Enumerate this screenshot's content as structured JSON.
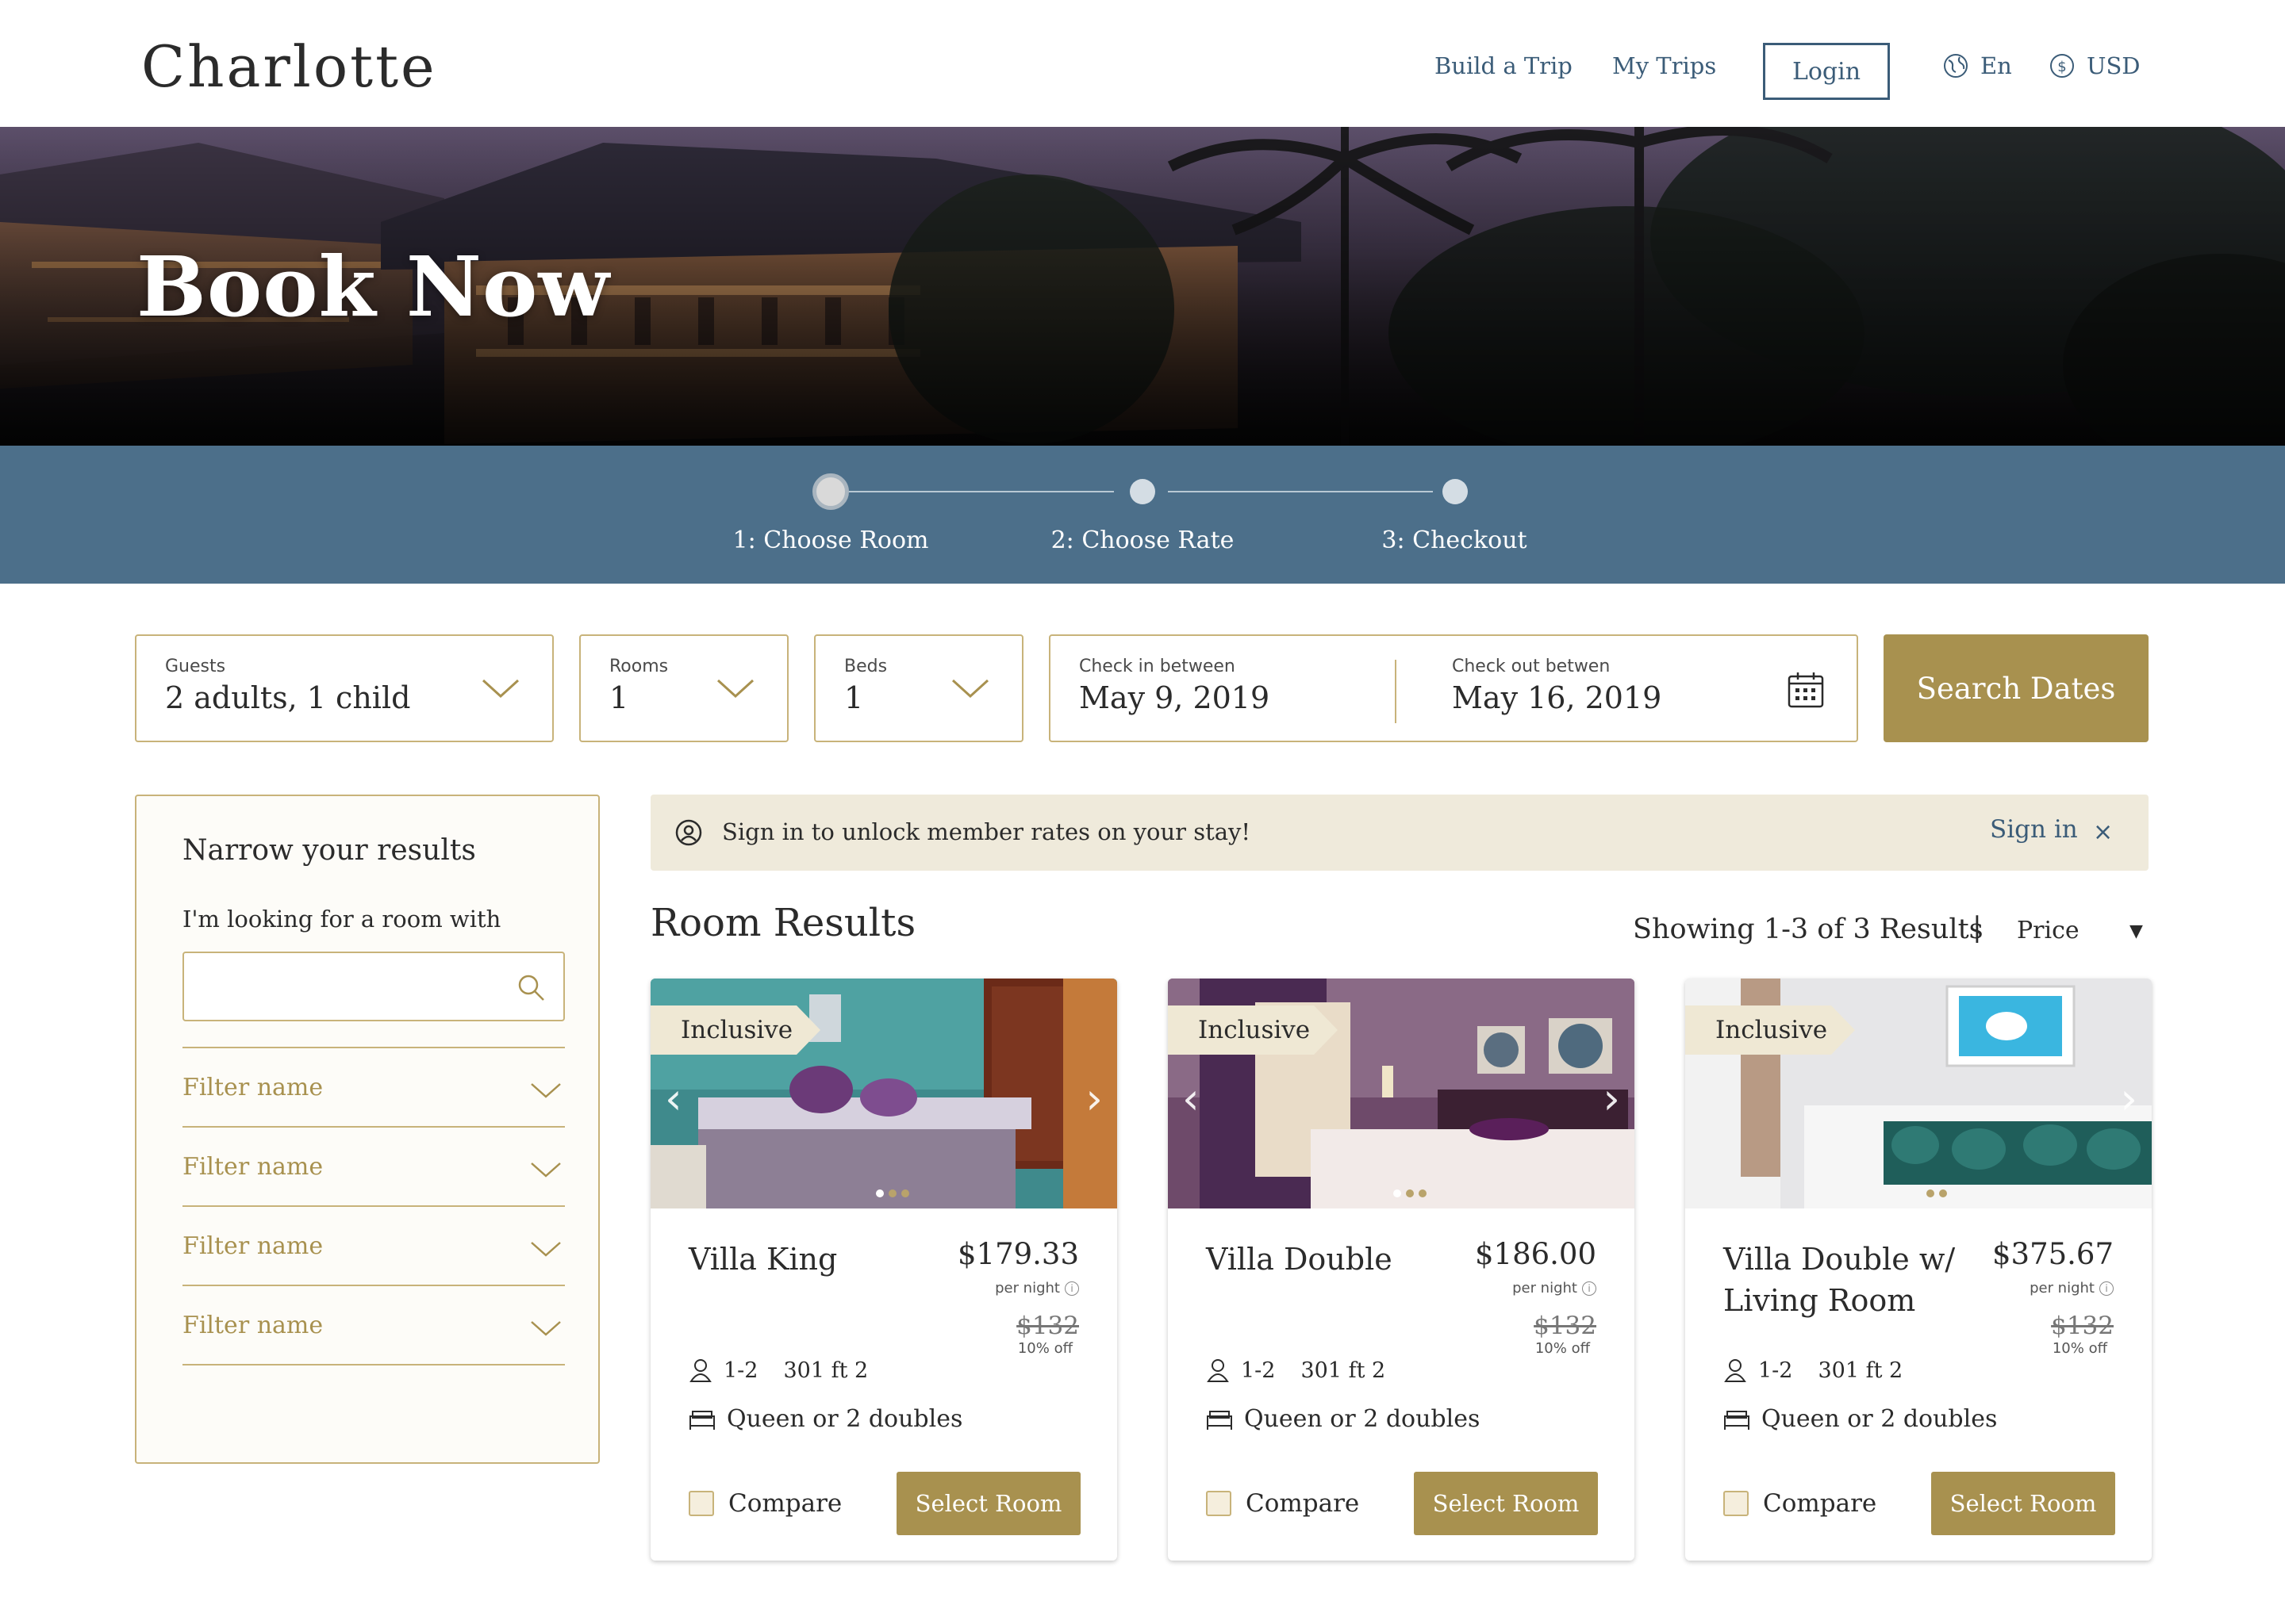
{
  "header": {
    "logo": "Charlotte",
    "nav": [
      "Build a Trip",
      "My Trips"
    ],
    "login": "Login",
    "language": "En",
    "currency": "USD"
  },
  "hero": {
    "title": "Book Now"
  },
  "stepper": {
    "steps": [
      "1: Choose Room",
      "2: Choose Rate",
      "3: Checkout"
    ],
    "active_step": 1
  },
  "search": {
    "guests_label": "Guests",
    "guests_value": "2 adults, 1 child",
    "rooms_label": "Rooms",
    "rooms_value": "1",
    "beds_label": "Beds",
    "beds_value": "1",
    "checkin_label": "Check in between",
    "checkin_value": "May 9, 2019",
    "checkout_label": "Check out betwen",
    "checkout_value": "May 16, 2019",
    "button": "Search Dates"
  },
  "filters": {
    "title": "Narrow your results",
    "search_label": "I'm looking for a room with",
    "search_placeholder": "",
    "items": [
      "Filter name",
      "Filter name",
      "Filter name",
      "Filter name"
    ]
  },
  "banner": {
    "text": "Sign in to unlock member rates on your stay!",
    "link": "Sign in",
    "close": "×"
  },
  "results": {
    "title": "Room Results",
    "showing": "Showing 1-3 of 3 Results",
    "separator": "|",
    "sort": "Price"
  },
  "rooms": [
    {
      "badge": "Inclusive",
      "name": "Villa King",
      "price": "$179.33",
      "per_night": "per night",
      "old_price": "$132",
      "discount": "10% off",
      "guests": "1-2",
      "size": "301 ft 2",
      "beds": "Queen or 2 doubles",
      "compare": "Compare",
      "select": "Select Room"
    },
    {
      "badge": "Inclusive",
      "name": "Villa Double",
      "price": "$186.00",
      "per_night": "per night",
      "old_price": "$132",
      "discount": "10% off",
      "guests": "1-2",
      "size": "301 ft 2",
      "beds": "Queen or 2 doubles",
      "compare": "Compare",
      "select": "Select Room"
    },
    {
      "badge": "Inclusive",
      "name": "Villa Double w/ Living Room",
      "price": "$375.67",
      "per_night": "per night",
      "old_price": "$132",
      "discount": "10% off",
      "guests": "1-2",
      "size": "301 ft 2",
      "beds": "Queen or 2 doubles",
      "compare": "Compare",
      "select": "Select Room"
    }
  ],
  "colors": {
    "accent_gold": "#a8914f",
    "nav_blue": "#3b5c78",
    "stepper_bg": "#4c6f8a",
    "banner_bg": "#efeadb"
  }
}
